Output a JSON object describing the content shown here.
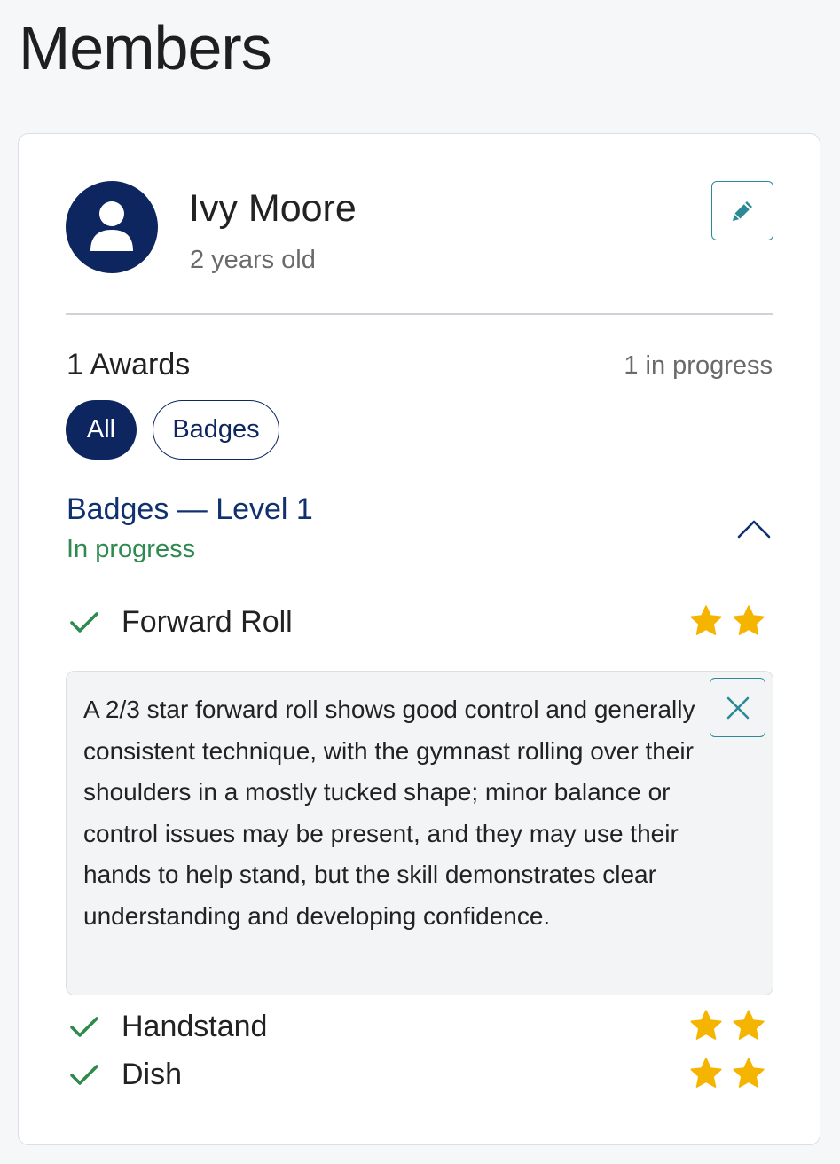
{
  "page": {
    "title": "Members"
  },
  "member": {
    "name": "Ivy Moore",
    "age": "2 years old",
    "avatar_icon": "user-icon",
    "edit_icon": "pencil-icon"
  },
  "awards": {
    "count_label": "1 Awards",
    "in_progress_label": "1 in progress",
    "filters": [
      {
        "label": "All",
        "selected": true
      },
      {
        "label": "Badges",
        "selected": false
      }
    ]
  },
  "section": {
    "title": "Badges — Level 1",
    "status": "In progress",
    "toggle_icon": "chevron-up-icon",
    "skills": [
      {
        "name": "Forward Roll",
        "completed": true,
        "stars": 2
      },
      {
        "name": "Handstand",
        "completed": true,
        "stars": 2
      },
      {
        "name": "Dish",
        "completed": true,
        "stars": 2
      }
    ],
    "info": {
      "text": "A 2/3 star forward roll shows good control and generally consistent technique, with the gymnast rolling over their shoulders in a mostly tucked shape; minor balance or control issues may be present, and they may use their hands to help stand, but the skill demonstrates clear understanding and developing confidence.",
      "close_icon": "close-icon"
    }
  },
  "colors": {
    "primary": "#0d2660",
    "accent": "#2b8a96",
    "success": "#2e8a4f",
    "star": "#f5b400",
    "background": "#f6f7f9"
  }
}
